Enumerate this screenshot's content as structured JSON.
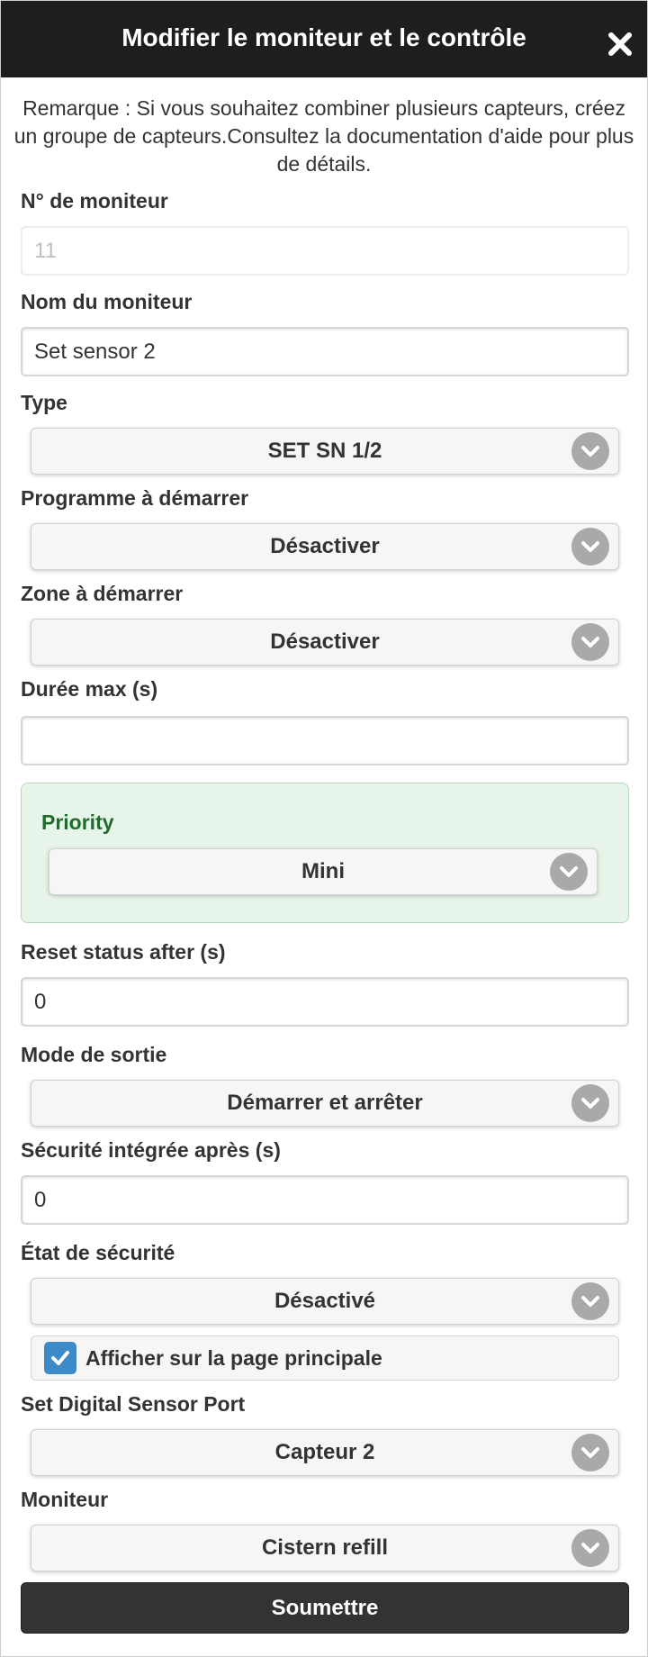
{
  "header": {
    "title": "Modifier le moniteur et le contrôle",
    "close_icon": "close-icon"
  },
  "note": "Remarque : Si vous souhaitez combiner plusieurs capteurs, créez un groupe de capteurs.Consultez la documentation d'aide pour plus de détails.",
  "fields": {
    "monitor_no": {
      "label": "N° de moniteur",
      "value": "11"
    },
    "monitor_name": {
      "label": "Nom du moniteur",
      "value": "Set sensor 2"
    },
    "type": {
      "label": "Type",
      "value": "SET SN 1/2"
    },
    "program": {
      "label": "Programme à démarrer",
      "value": "Désactiver"
    },
    "zone": {
      "label": "Zone à démarrer",
      "value": "Désactiver"
    },
    "max_duration": {
      "label": "Durée max (s)",
      "value": ""
    },
    "priority": {
      "label": "Priority",
      "value": "Mini"
    },
    "reset_status": {
      "label": "Reset status after (s)",
      "value": "0"
    },
    "output_mode": {
      "label": "Mode de sortie",
      "value": "Démarrer et arrêter"
    },
    "failsafe_after": {
      "label": "Sécurité intégrée après (s)",
      "value": "0"
    },
    "failsafe_state": {
      "label": "État de sécurité",
      "value": "Désactivé"
    },
    "show_main": {
      "label": "Afficher sur la page principale",
      "checked": true
    },
    "digital_port": {
      "label": "Set Digital Sensor Port",
      "value": "Capteur 2"
    },
    "monitor": {
      "label": "Moniteur",
      "value": "Cistern refill"
    }
  },
  "submit_label": "Soumettre",
  "colors": {
    "header_bg": "#1e1e1e",
    "priority_bg": "#e6f4e9",
    "priority_text": "#1f6b2a",
    "checkbox": "#3d8ac9",
    "submit_bg": "#333333"
  }
}
